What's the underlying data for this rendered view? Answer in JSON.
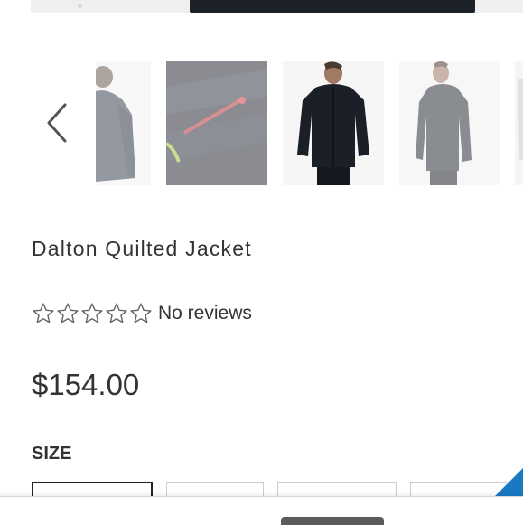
{
  "product": {
    "title": "Dalton Quilted Jacket",
    "rating": {
      "stars_filled": 0,
      "stars_total": 5,
      "reviews_text": "No reviews"
    },
    "price": "$154.00",
    "size_label": "SIZE",
    "size_options_visible": 4
  },
  "carousel": {
    "prev_icon": "chevron-left-icon",
    "thumbnails": [
      "back-view",
      "zipper-detail",
      "front-view",
      "side-view",
      "partial"
    ]
  },
  "colors": {
    "text": "#333333",
    "accent": "#1979c3",
    "selected_border": "#222222"
  }
}
